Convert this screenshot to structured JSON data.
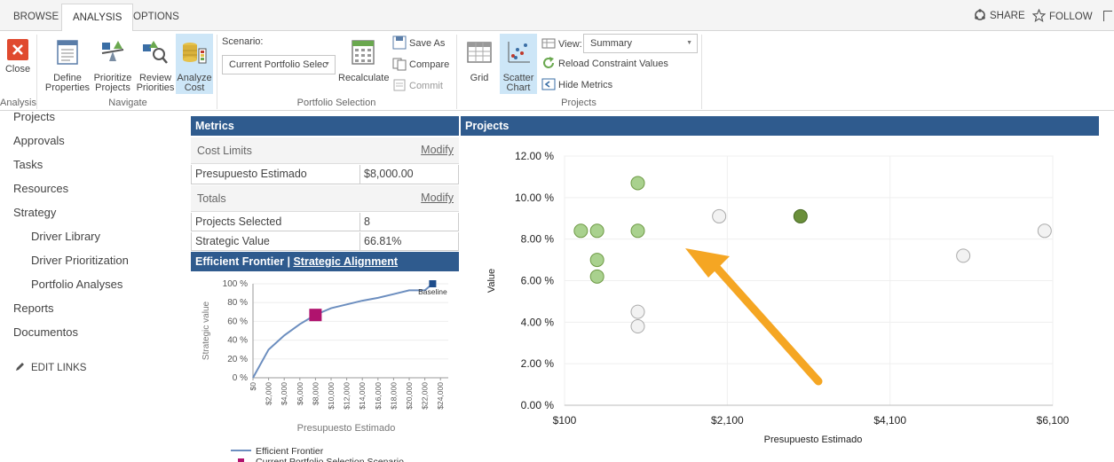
{
  "top_tabs": [
    "BROWSE",
    "ANALYSIS",
    "OPTIONS"
  ],
  "top_actions": {
    "share": "SHARE",
    "follow": "FOLLOW"
  },
  "ribbon": {
    "close": "Close",
    "analysis_group": "Analysis",
    "define_properties": [
      "Define",
      "Properties"
    ],
    "prioritize_projects": [
      "Prioritize",
      "Projects"
    ],
    "review_priorities": [
      "Review",
      "Priorities"
    ],
    "analyze_cost": [
      "Analyze",
      "Cost"
    ],
    "navigate_group": "Navigate",
    "scenario_label": "Scenario:",
    "scenario_value": "Current Portfolio Selec",
    "recalculate": "Recalculate",
    "save_as": "Save As",
    "compare": "Compare",
    "commit": "Commit",
    "portfolio_group": "Portfolio Selection",
    "grid": "Grid",
    "scatter_chart": [
      "Scatter",
      "Chart"
    ],
    "view_label": "View:",
    "view_value": "Summary",
    "reload": "Reload Constraint Values",
    "hide_metrics": "Hide Metrics",
    "projects_group": "Projects"
  },
  "nav": {
    "items": [
      "Projects",
      "Approvals",
      "Tasks",
      "Resources",
      "Strategy"
    ],
    "sub_items": [
      "Driver Library",
      "Driver Prioritization",
      "Portfolio Analyses"
    ],
    "items2": [
      "Reports",
      "Documentos"
    ],
    "edit_links": "EDIT LINKS"
  },
  "metrics": {
    "title": "Metrics",
    "cost_limits": "Cost Limits",
    "modify": "Modify",
    "presupuesto_label": "Presupuesto Estimado",
    "presupuesto_value": "$8,000.00",
    "totals": "Totals",
    "projects_selected_label": "Projects Selected",
    "projects_selected_value": "8",
    "strategic_value_label": "Strategic Value",
    "strategic_value_value": "66.81%"
  },
  "frontier": {
    "title_prefix": "Efficient Frontier | ",
    "title_link": "Strategic Alignment",
    "ylabel": "Strategic value",
    "xlabel": "Presupuesto Estimado",
    "baseline_label": "Baseline",
    "legend": [
      "Efficient Frontier",
      "Current Portfolio Selection Scenario"
    ]
  },
  "projects_panel": {
    "title": "Projects"
  },
  "colors": {
    "header_blue": "#2f5b8e",
    "arrow": "#f5a623",
    "selected_green": "#a9d18e",
    "dark_green": "#6a8f3a",
    "unselected": "#f2f2f2"
  },
  "chart_data": [
    {
      "type": "line",
      "title": "Efficient Frontier",
      "xlabel": "Presupuesto Estimado",
      "ylabel": "Strategic value",
      "x_ticks": [
        "$0",
        "$2,000",
        "$4,000",
        "$6,000",
        "$8,000",
        "$10,000",
        "$12,000",
        "$14,000",
        "$16,000",
        "$18,000",
        "$20,000",
        "$22,000",
        "$24,000"
      ],
      "y_ticks": [
        "0 %",
        "20 %",
        "40 %",
        "60 %",
        "80 %",
        "100 %"
      ],
      "xlim": [
        0,
        25000
      ],
      "ylim": [
        0,
        100
      ],
      "series": [
        {
          "name": "Efficient Frontier",
          "x": [
            0,
            2000,
            4000,
            6000,
            8000,
            10000,
            12000,
            14000,
            16000,
            18000,
            20000,
            22000,
            23000
          ],
          "y": [
            0,
            30,
            45,
            57,
            67,
            74,
            78,
            82,
            85,
            89,
            93,
            93,
            100
          ]
        }
      ],
      "current_selection": {
        "x": 8000,
        "y": 66.81
      },
      "baseline": {
        "x": 23000,
        "y": 100
      }
    },
    {
      "type": "scatter",
      "xlabel": "Presupuesto Estimado",
      "ylabel": "Value",
      "x_ticks": [
        "$100",
        "$2,100",
        "$4,100",
        "$6,100"
      ],
      "y_ticks": [
        "0.00 %",
        "2.00 %",
        "4.00 %",
        "6.00 %",
        "8.00 %",
        "10.00 %",
        "12.00 %"
      ],
      "xlim": [
        100,
        6100
      ],
      "ylim": [
        0,
        12
      ],
      "grid": true,
      "points": [
        {
          "x": 300,
          "y": 8.4,
          "selected": true
        },
        {
          "x": 500,
          "y": 8.4,
          "selected": true
        },
        {
          "x": 500,
          "y": 7.0,
          "selected": true
        },
        {
          "x": 500,
          "y": 6.2,
          "selected": true
        },
        {
          "x": 1000,
          "y": 10.7,
          "selected": true
        },
        {
          "x": 1000,
          "y": 8.4,
          "selected": true
        },
        {
          "x": 1000,
          "y": 4.5,
          "selected": false
        },
        {
          "x": 1000,
          "y": 3.8,
          "selected": false
        },
        {
          "x": 2000,
          "y": 9.1,
          "selected": false
        },
        {
          "x": 3000,
          "y": 9.1,
          "selected": true,
          "highlight": true
        },
        {
          "x": 5000,
          "y": 7.2,
          "selected": false
        },
        {
          "x": 6000,
          "y": 8.4,
          "selected": false
        }
      ]
    }
  ]
}
